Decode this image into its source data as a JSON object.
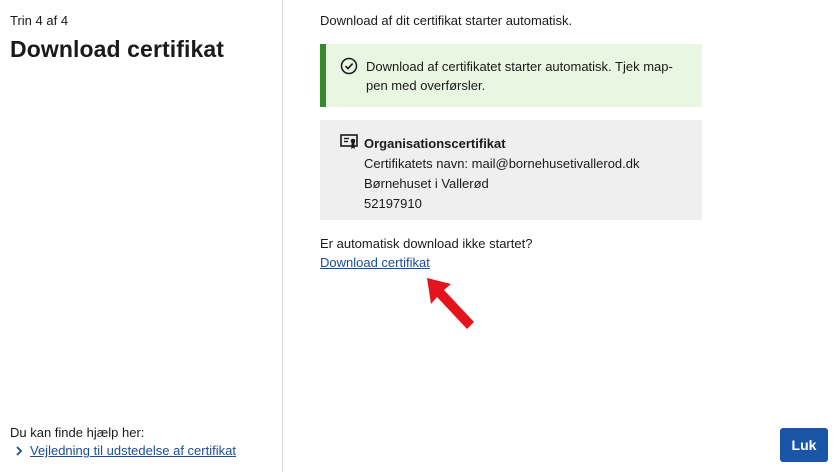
{
  "left": {
    "step": "Trin 4 af 4",
    "title": "Download certifikat",
    "help_heading": "Du kan finde hjælp her:",
    "help_link": "Vejledning til udstedelse af certifikat"
  },
  "main": {
    "intro": "Download af dit certifikat starter automatisk.",
    "success_message": "Download af certifikatet starter automatisk. Tjek map-pen med overførsler.",
    "certificate": {
      "type": "Organisationscertifikat",
      "name_line": "Certifikatets navn: mail@bornehusetivallerod.dk",
      "organization": "Børnehuset i Vallerød",
      "number": "52197910"
    },
    "retry_question": "Er automatisk download ikke startet?",
    "download_link": "Download certifikat"
  },
  "footer": {
    "close_label": "Luk"
  },
  "icons": {
    "success": "check-circle-icon",
    "certificate": "certificate-icon",
    "help_link": "chevron-right-icon",
    "annotation": "red-arrow-icon"
  },
  "colors": {
    "success_bg": "#e9f6e1",
    "success_border": "#358a2b",
    "link": "#1a4d9a",
    "button": "#1a55a8",
    "annotation_arrow": "#e3141b",
    "cert_bg": "#efefef"
  }
}
